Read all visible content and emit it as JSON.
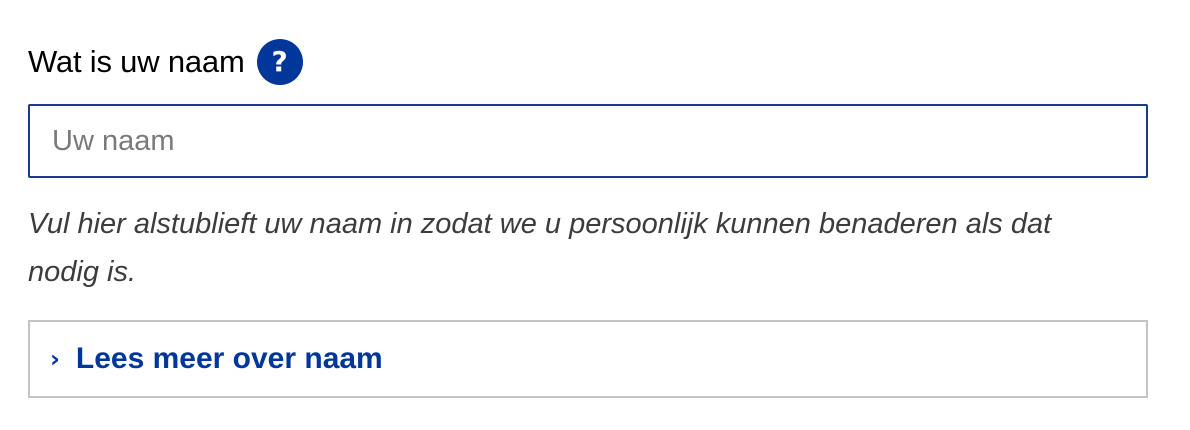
{
  "field": {
    "label": "Wat is uw naam",
    "help_icon": "question-mark-icon",
    "help_glyph": "?",
    "input_value": "",
    "input_placeholder": "Uw naam",
    "hint": "Vul hier alstublieft uw naam in zodat we u persoonlijk kunnen benaderen als dat nodig is."
  },
  "details": {
    "chevron_icon": "chevron-right-icon",
    "chevron_glyph": "›",
    "label": "Lees meer over naam"
  },
  "colors": {
    "accent": "#01369a",
    "input_border": "#1a3a8f",
    "details_border": "#c4c4c4",
    "hint_text": "#3c3c3c"
  }
}
